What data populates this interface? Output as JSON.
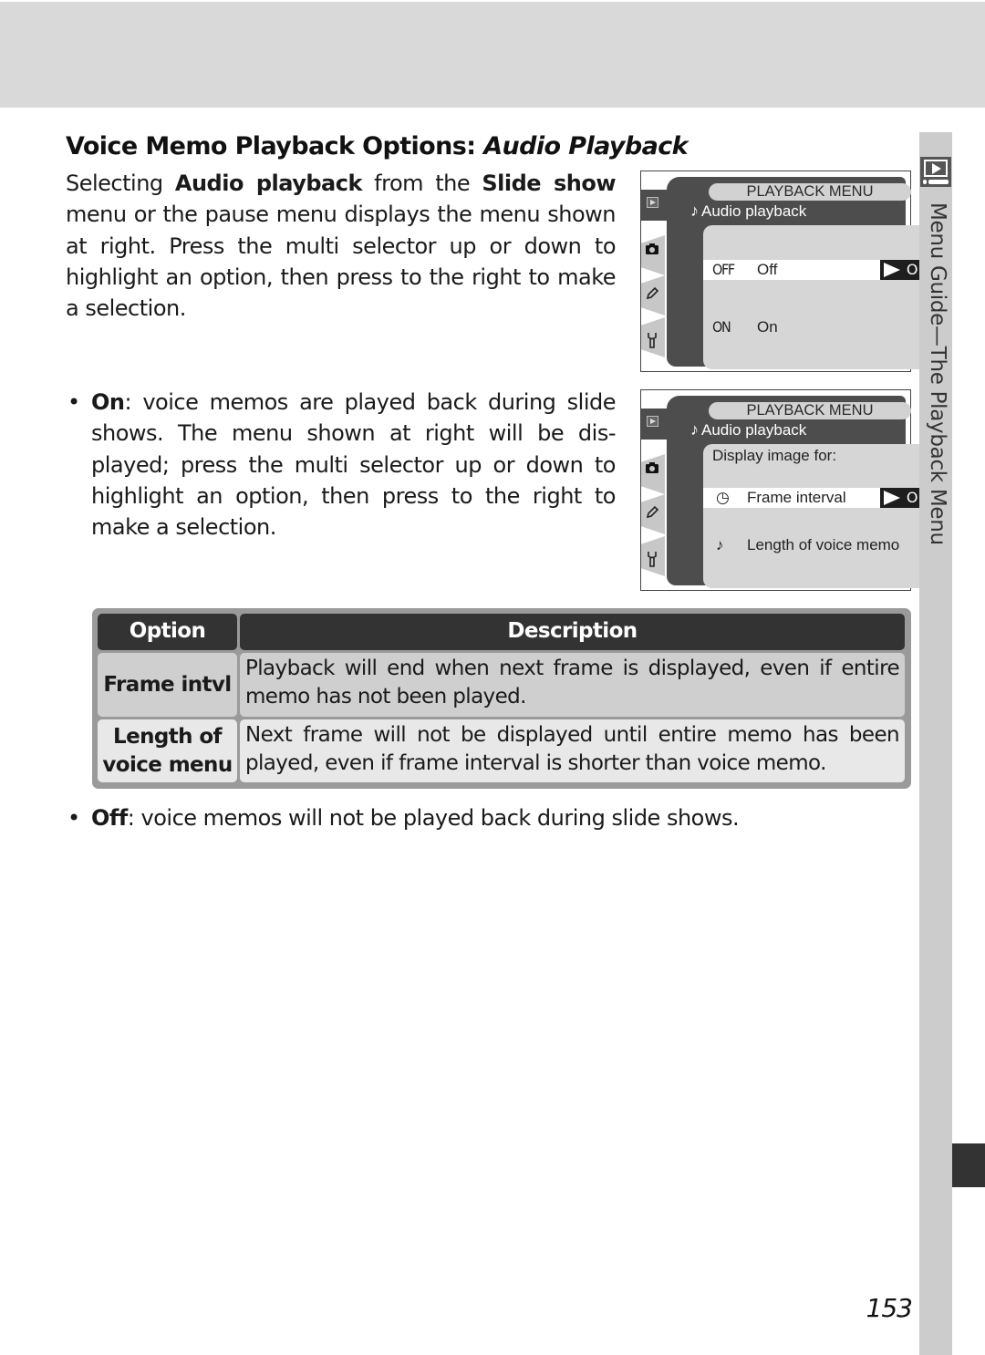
{
  "page": {
    "section_title": {
      "regular": "Voice Memo Playback Options: ",
      "italic": "Audio Playback"
    },
    "intro": {
      "part1": "Selecting ",
      "bold1": "Audio playback",
      "part2": " from the ",
      "bold2": "Slide show",
      "part3": " menu or the pause menu displays the menu shown at right.  Press the multi selector up or down to highlight an option, then press to the right to make a selection."
    },
    "bullet_on": {
      "bullet": "•",
      "bold": "On",
      "text": ": voice memos are played back during slide shows.  The menu shown at right will be dis-played; press the multi selector up or down to highlight an option, then press to the right to make a selection."
    },
    "bullet_off": {
      "bullet": "•",
      "bold": "Off",
      "text": ": voice memos will not be played back during slide shows."
    },
    "page_number": "153",
    "side_tab_label": "Menu Guide—The Playback Menu"
  },
  "lcd_screens": [
    {
      "menu_title": "PLAYBACK MENU",
      "note_icon": "♪",
      "subtitle": "Audio playback",
      "tab_icons": {
        "camera": "camera-icon",
        "pencil": "pencil-icon",
        "wrench": "wrench-icon"
      },
      "options": [
        {
          "code": "OFF",
          "label": "Off",
          "selected": true
        },
        {
          "code": "ON",
          "label": "On",
          "selected": false
        }
      ],
      "ok_label": "OK"
    },
    {
      "menu_title": "PLAYBACK MENU",
      "note_icon": "♪",
      "subtitle": "Audio playback",
      "panel_label": "Display image for:",
      "options": [
        {
          "icon": "◷",
          "icon_name": "timer-icon",
          "label": "Frame interval",
          "selected": true
        },
        {
          "icon": "♪",
          "icon_name": "note-icon",
          "label": "Length of voice memo",
          "selected": false
        }
      ],
      "ok_label": "OK"
    }
  ],
  "table": {
    "headers": [
      "Option",
      "Description"
    ],
    "rows": [
      {
        "option": "Frame intvl",
        "description": "Playback will end when next frame is displayed, even if entire memo has not been played."
      },
      {
        "option_line1": "Length of",
        "option_line2": "voice menu",
        "description": "Next frame will not be displayed until entire memo has been played, even if frame interval is shorter than voice memo."
      }
    ]
  }
}
